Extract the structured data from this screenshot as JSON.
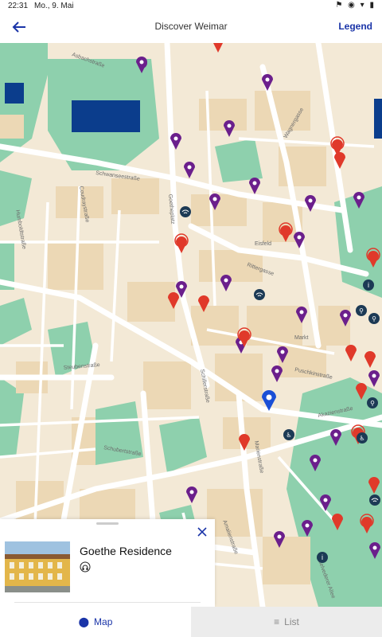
{
  "status": {
    "time": "22:31",
    "date": "Mo., 9. Mai"
  },
  "header": {
    "title": "Discover Weimar",
    "legend_label": "Legend"
  },
  "map": {
    "street_labels": [
      "Asbachstraße",
      "Schwanseestraße",
      "Coudraystraße",
      "Goetheplatz",
      "Rittergasse",
      "Markt",
      "Puschkinstraße",
      "Steubenstraße",
      "Schillerstraße",
      "Akazienstraße",
      "Marienstraße",
      "Schubertstraße",
      "Amalienstraße",
      "Belvederer Allee",
      "Eisfeld",
      "Humboldtstraße",
      "Wagnergasse"
    ],
    "colors": {
      "park": "#8ed0ad",
      "building": "#ecd8b5",
      "road": "#ffffff",
      "purple_pin": "#6b1f8c",
      "red_pin": "#e0392a",
      "blue_pin": "#1a4fd6",
      "water": "#0b3d8c"
    }
  },
  "card": {
    "title": "Goethe Residence",
    "icon": "headphones-icon"
  },
  "tabs": {
    "map_label": "Map",
    "list_label": "List",
    "active": "Map"
  }
}
